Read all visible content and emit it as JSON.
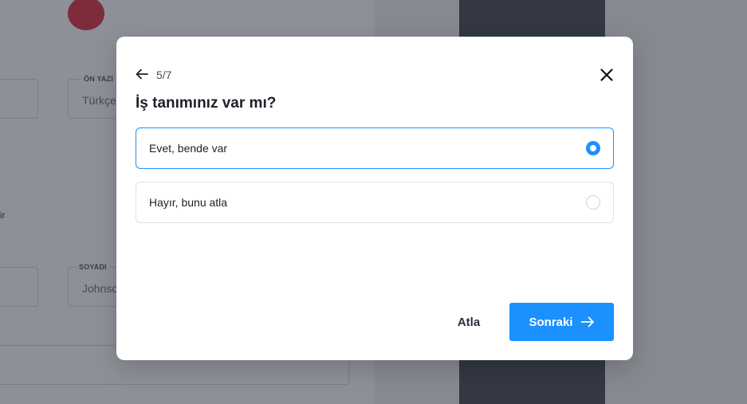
{
  "background": {
    "field_label_on_yazi": "ÖN YAZI",
    "field_value_on_yazi": "Türkçe",
    "field_label_soyadi": "SOYADI",
    "field_placeholder_soyadi": "Johnson",
    "left_text_fragment": "ir",
    "avatar_color": "#e0344a"
  },
  "modal": {
    "step": "5/7",
    "question": "İş tanımınız var mı?",
    "options": [
      {
        "label": "Evet, bende var",
        "selected": true
      },
      {
        "label": "Hayır, bunu atla",
        "selected": false
      }
    ],
    "skip_label": "Atla",
    "next_label": "Sonraki",
    "icons": {
      "back": "arrow-left-icon",
      "close": "close-icon",
      "next": "arrow-right-icon"
    }
  },
  "colors": {
    "accent": "#1a91ff",
    "overlay": "rgba(27,33,45,0.5)",
    "text_primary": "#1d2029"
  }
}
